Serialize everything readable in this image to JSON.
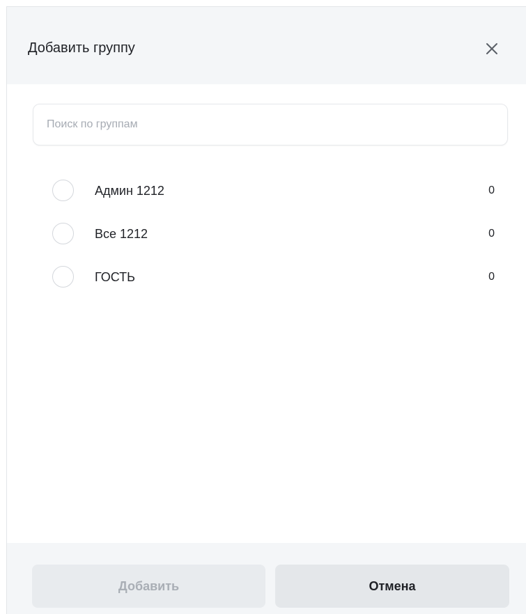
{
  "dialog": {
    "title": "Добавить группу",
    "close_icon": "close-icon"
  },
  "search": {
    "placeholder": "Поиск по группам",
    "value": ""
  },
  "groups": [
    {
      "label": "Админ 1212",
      "count": "0",
      "selected": false
    },
    {
      "label": "Все 1212",
      "count": "0",
      "selected": false
    },
    {
      "label": "ГОСТЬ",
      "count": "0",
      "selected": false
    }
  ],
  "footer": {
    "add_label": "Добавить",
    "add_disabled": true,
    "cancel_label": "Отмена"
  },
  "colors": {
    "header_bg": "#f4f6f8",
    "text": "#1f2126",
    "disabled_text": "#a9aeb5"
  }
}
